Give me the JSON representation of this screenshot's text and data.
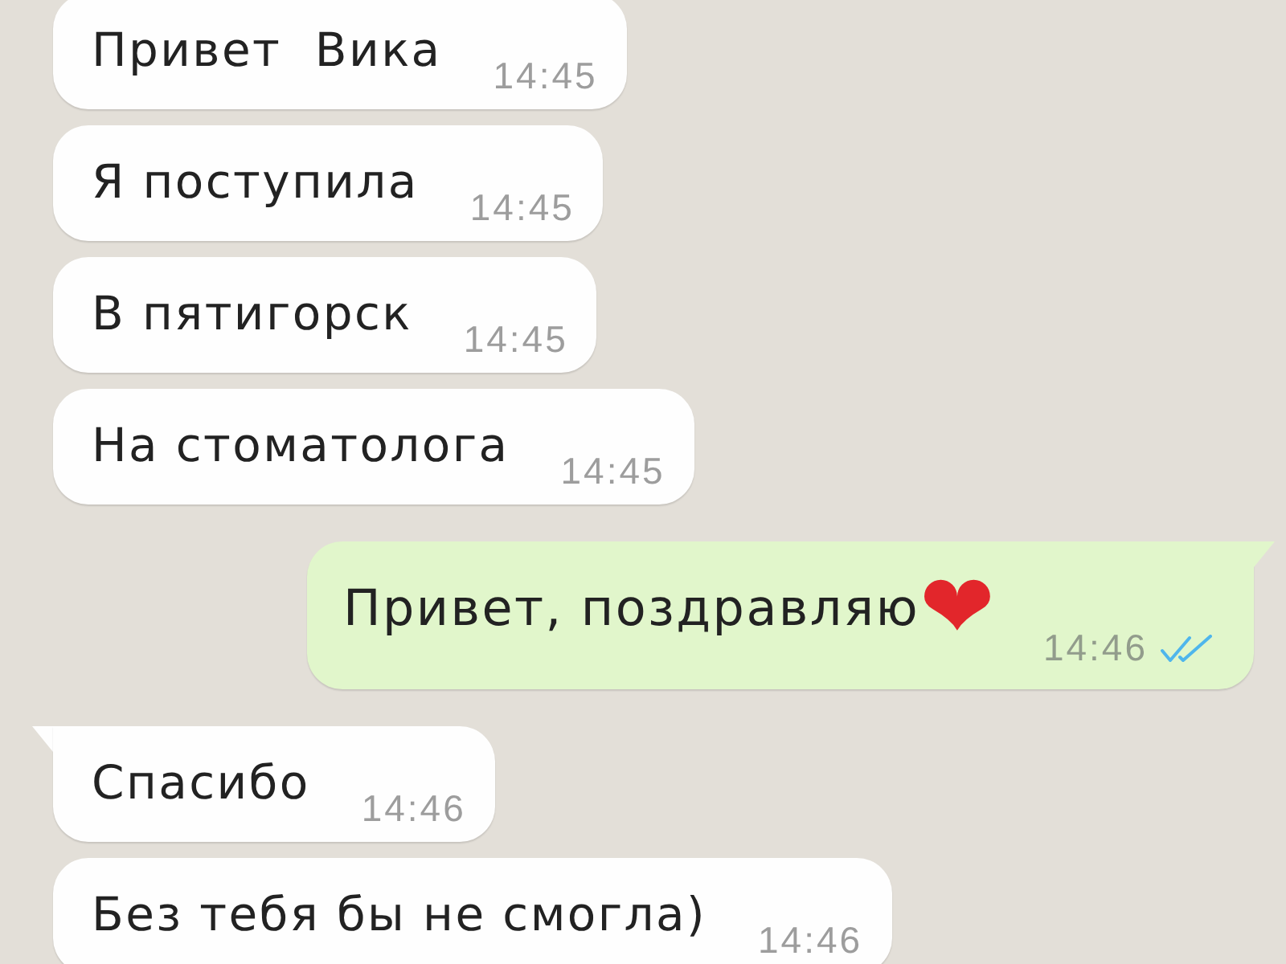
{
  "messages": [
    {
      "kind": "incoming",
      "text": "Привет  Вика",
      "time": "14:45",
      "tail": false
    },
    {
      "kind": "incoming",
      "text": "Я поступила",
      "time": "14:45",
      "tail": false
    },
    {
      "kind": "incoming",
      "text": "В пятигорск",
      "time": "14:45",
      "tail": false
    },
    {
      "kind": "incoming",
      "text": "На стоматолога",
      "time": "14:45",
      "tail": false
    },
    {
      "kind": "outgoing",
      "text": "Привет, поздравляю",
      "emoji": "❤",
      "time": "14:46",
      "read": true,
      "tail": true
    },
    {
      "kind": "incoming",
      "text": "Спасибо",
      "time": "14:46",
      "tail": true
    },
    {
      "kind": "incoming",
      "text": "Без тебя бы не смогла)",
      "time": "14:46",
      "tail": false
    }
  ]
}
